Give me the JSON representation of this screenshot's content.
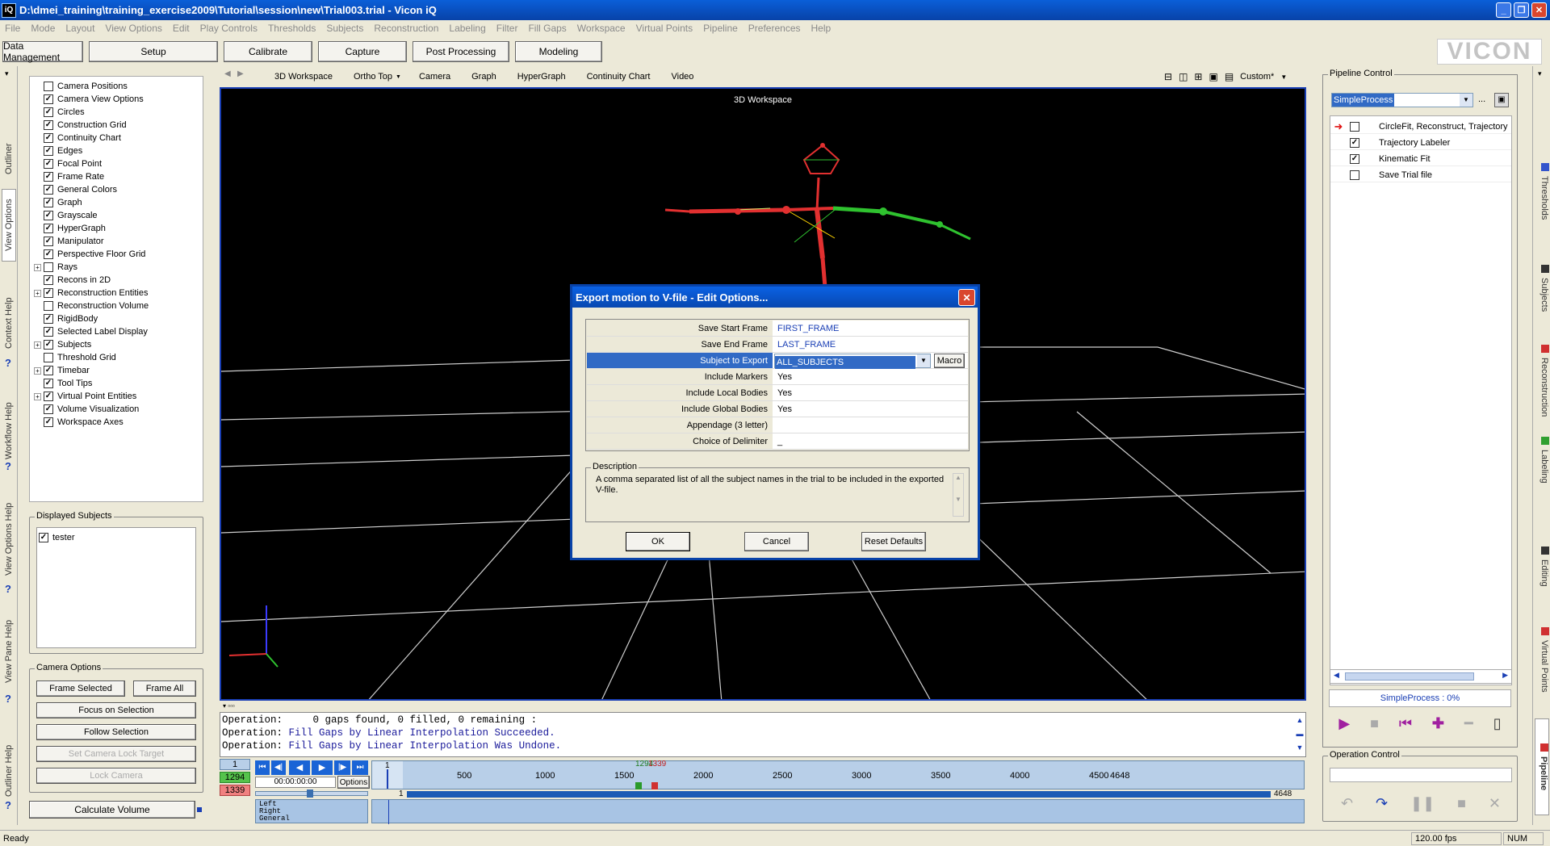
{
  "window": {
    "title": "D:\\dmei_training\\training_exercise2009\\Tutorial\\session\\new\\Trial003.trial - Vicon iQ",
    "app_icon": "iQ"
  },
  "menu": [
    "File",
    "Mode",
    "Layout",
    "View Options",
    "Edit",
    "Play Controls",
    "Thresholds",
    "Subjects",
    "Reconstruction",
    "Labeling",
    "Filter",
    "Fill Gaps",
    "Workspace",
    "Virtual Points",
    "Pipeline",
    "Preferences",
    "Help"
  ],
  "modes": [
    "Data Management",
    "Setup",
    "Calibrate",
    "Capture",
    "Post Processing",
    "Modeling"
  ],
  "logo": "VICON",
  "left_tabs": [
    "Outliner",
    "View Options",
    "Context Help",
    "Workflow Help",
    "View Options Help",
    "View Pane Help",
    "Outliner Help"
  ],
  "tree": [
    {
      "label": "Camera Positions",
      "checked": false,
      "expand": false
    },
    {
      "label": "Camera View Options",
      "checked": true,
      "expand": false
    },
    {
      "label": "Circles",
      "checked": true,
      "expand": false
    },
    {
      "label": "Construction Grid",
      "checked": true,
      "expand": false
    },
    {
      "label": "Continuity Chart",
      "checked": true,
      "expand": false
    },
    {
      "label": "Edges",
      "checked": true,
      "expand": false
    },
    {
      "label": "Focal Point",
      "checked": true,
      "expand": false
    },
    {
      "label": "Frame Rate",
      "checked": true,
      "expand": false
    },
    {
      "label": "General Colors",
      "checked": true,
      "expand": false
    },
    {
      "label": "Graph",
      "checked": true,
      "expand": false
    },
    {
      "label": "Grayscale",
      "checked": true,
      "expand": false
    },
    {
      "label": "HyperGraph",
      "checked": true,
      "expand": false
    },
    {
      "label": "Manipulator",
      "checked": true,
      "expand": false
    },
    {
      "label": "Perspective Floor Grid",
      "checked": true,
      "expand": false
    },
    {
      "label": "Rays",
      "checked": false,
      "expand": true
    },
    {
      "label": "Recons in 2D",
      "checked": true,
      "expand": false
    },
    {
      "label": "Reconstruction Entities",
      "checked": true,
      "expand": true
    },
    {
      "label": "Reconstruction Volume",
      "checked": false,
      "expand": false
    },
    {
      "label": "RigidBody",
      "checked": true,
      "expand": false
    },
    {
      "label": "Selected Label Display",
      "checked": true,
      "expand": false
    },
    {
      "label": "Subjects",
      "checked": true,
      "expand": true
    },
    {
      "label": "Threshold Grid",
      "checked": false,
      "expand": false
    },
    {
      "label": "Timebar",
      "checked": true,
      "expand": true
    },
    {
      "label": "Tool Tips",
      "checked": true,
      "expand": false
    },
    {
      "label": "Virtual Point Entities",
      "checked": true,
      "expand": true
    },
    {
      "label": "Volume Visualization",
      "checked": true,
      "expand": false
    },
    {
      "label": "Workspace Axes",
      "checked": true,
      "expand": false
    }
  ],
  "displayed_subjects": {
    "title": "Displayed Subjects",
    "items": [
      "tester"
    ]
  },
  "camera_options": {
    "title": "Camera Options",
    "frame_selected": "Frame Selected",
    "frame_all": "Frame All",
    "focus": "Focus on Selection",
    "follow": "Follow Selection",
    "lock_target": "Set Camera Lock Target",
    "lock_camera": "Lock Camera"
  },
  "calc_volume": "Calculate Volume",
  "view_tabs": [
    "3D Workspace",
    "Ortho Top",
    "Camera",
    "Graph",
    "HyperGraph",
    "Continuity Chart",
    "Video"
  ],
  "layout_label": "Custom*",
  "viewport_title": "3D Workspace",
  "console": [
    {
      "prefix": "Operation:",
      "text": "     0 gaps found, 0 filled, 0 remaining :"
    },
    {
      "prefix": "Operation:",
      "text": " Fill Gaps by Linear Interpolation Succeeded."
    },
    {
      "prefix": "Operation:",
      "text": " Fill Gaps by Linear Interpolation Was Undone."
    }
  ],
  "frames": {
    "current": "1",
    "start": "1294",
    "end": "1339",
    "timecode": "00:00:00:00",
    "options": "Options",
    "range_start": "1",
    "range_end": "4648",
    "marker_green": "1294",
    "marker_red": "1339"
  },
  "ticks": [
    "500",
    "1000",
    "1500",
    "2000",
    "2500",
    "3000",
    "3500",
    "4000",
    "4500",
    "4648"
  ],
  "tracks": [
    "Left",
    "Right",
    "General"
  ],
  "pipeline": {
    "title": "Pipeline Control",
    "selected": "SimpleProcess",
    "browse": "...",
    "steps": [
      {
        "label": "CircleFit, Reconstruct, Trajectory",
        "checked": false,
        "current": true
      },
      {
        "label": "Trajectory Labeler",
        "checked": true,
        "current": false
      },
      {
        "label": "Kinematic Fit",
        "checked": true,
        "current": false
      },
      {
        "label": "Save Trial file",
        "checked": false,
        "current": false
      }
    ],
    "progress": "SimpleProcess : 0%"
  },
  "operation_control": {
    "title": "Operation Control"
  },
  "right_tabs": [
    "Thresholds",
    "Subjects",
    "Reconstruction",
    "Labeling",
    "Editing",
    "Virtual Points",
    "Pipeline"
  ],
  "dialog": {
    "title": "Export motion to V-file - Edit Options...",
    "rows": [
      {
        "key": "Save Start Frame",
        "value": "FIRST_FRAME",
        "blue": true
      },
      {
        "key": "Save End Frame",
        "value": "LAST_FRAME",
        "blue": true
      },
      {
        "key": "Subject to Export",
        "value": "ALL_SUBJECTS",
        "blue": false,
        "selected": true
      },
      {
        "key": "Include Markers",
        "value": "Yes",
        "blue": false
      },
      {
        "key": "Include Local Bodies",
        "value": "Yes",
        "blue": false
      },
      {
        "key": "Include Global Bodies",
        "value": "Yes",
        "blue": false
      },
      {
        "key": "Appendage (3 letter)",
        "value": "",
        "blue": false
      },
      {
        "key": "Choice of Delimiter",
        "value": "_",
        "blue": false
      }
    ],
    "macro": "Macro",
    "description_label": "Description",
    "description": "A comma separated list of all the subject names in the trial to be included in the exported V-file.",
    "ok": "OK",
    "cancel": "Cancel",
    "reset": "Reset Defaults"
  },
  "status": {
    "left": "Ready",
    "fps": "120.00 fps",
    "num": "NUM"
  }
}
